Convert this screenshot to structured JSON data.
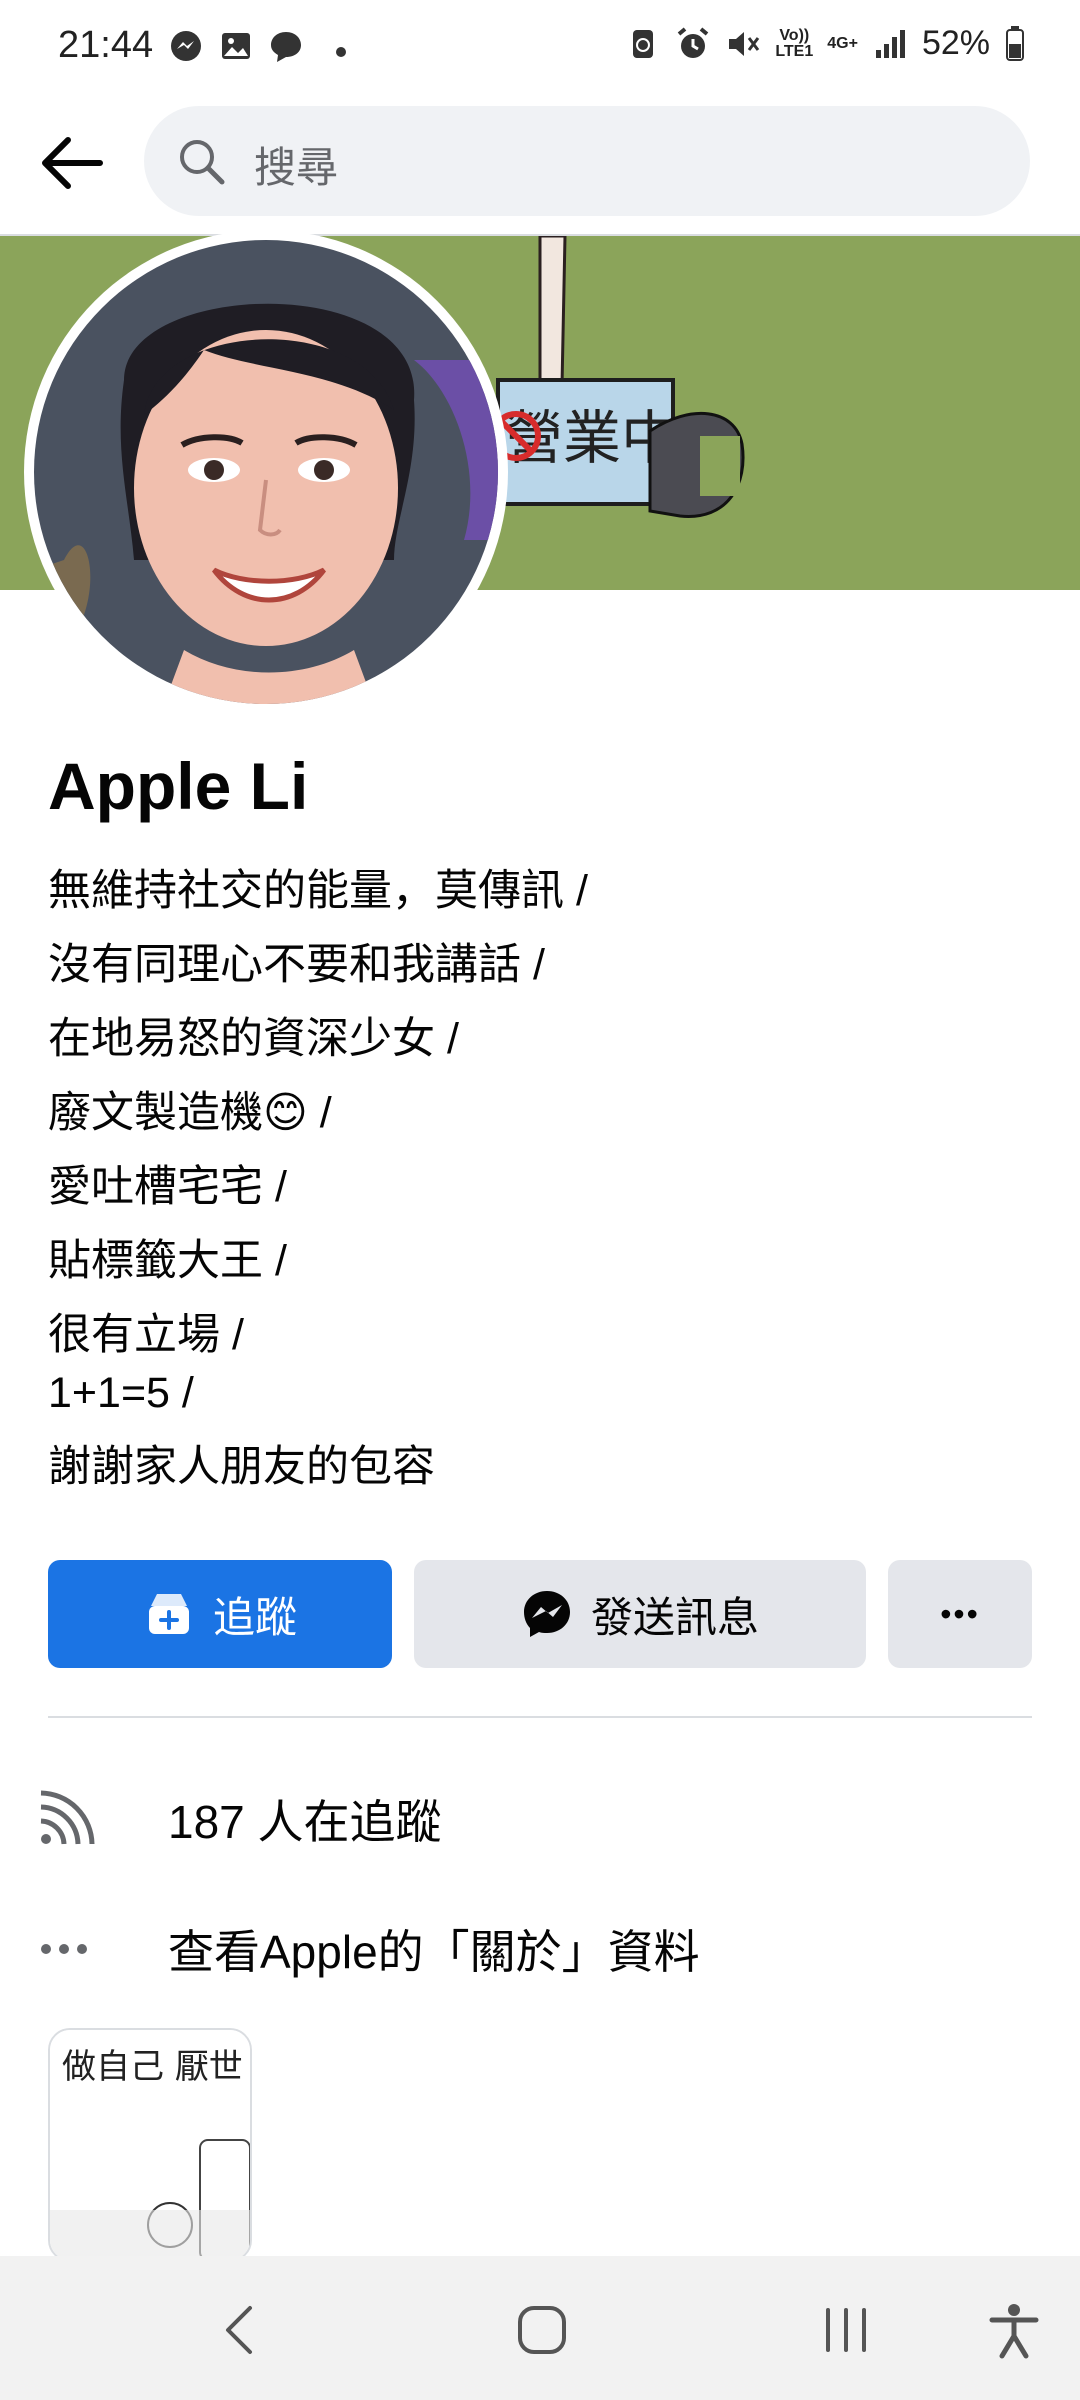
{
  "status_bar": {
    "time": "21:44",
    "battery": "52%",
    "volte_label": "Vo))\nLTE1",
    "network_label": "4G+",
    "icons": [
      "messenger-icon",
      "gallery-icon",
      "chat-bubble-icon",
      "dot-icon",
      "recycle-battery-icon",
      "alarm-icon",
      "mute-icon",
      "volte-icon",
      "4g-icon",
      "signal-icon",
      "battery-icon"
    ]
  },
  "top_bar": {
    "search_placeholder": "搜尋"
  },
  "profile": {
    "name": "Apple Li",
    "bio_lines": [
      "無維持社交的能量，莫傳訊 /",
      "沒有同理心不要和我講話 /",
      "在地易怒的資深少女 /",
      "廢文製造機😊 /",
      "愛吐槽宅宅 /",
      "貼標籤大王 /",
      "很有立場 /",
      "1+1=5 /",
      "謝謝家人朋友的包容"
    ],
    "cover_sign_text": "營業中",
    "featured_text": "做自己\n厭世"
  },
  "actions": {
    "follow_label": "追蹤",
    "message_label": "發送訊息",
    "more_label": "•••"
  },
  "info": {
    "followers": "187 人在追蹤",
    "about": "查看Apple的「關於」資料"
  },
  "colors": {
    "accent": "#1b74e4",
    "cover": "#8ba45a",
    "secondary_button": "#e4e6eb"
  }
}
